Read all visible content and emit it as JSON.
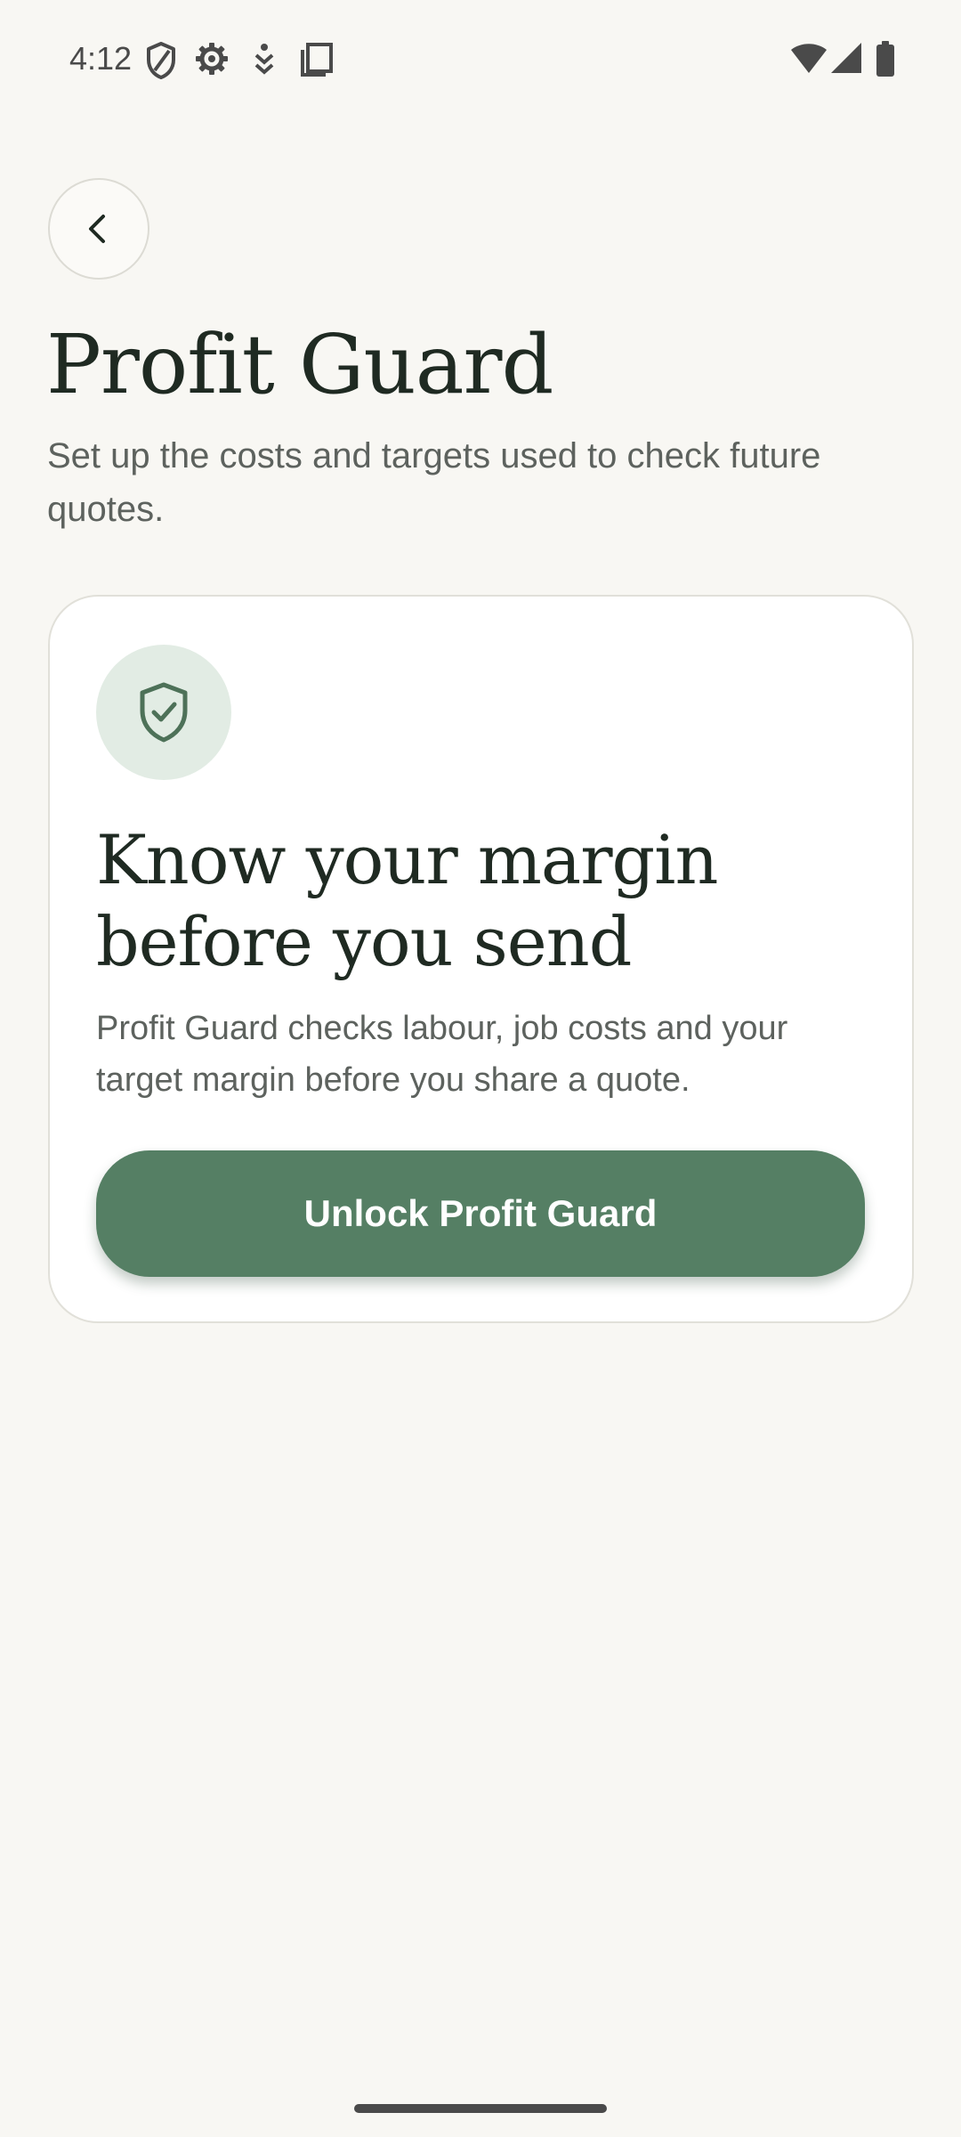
{
  "status_bar": {
    "time": "4:12",
    "left_icons": [
      "shield-status-icon",
      "gear-status-icon",
      "download-status-icon",
      "copy-status-icon"
    ],
    "right_icons": [
      "wifi-icon",
      "cellular-signal-icon",
      "battery-icon"
    ]
  },
  "header": {
    "back_icon": "chevron-left-icon",
    "title": "Profit Guard",
    "subtitle": "Set up the costs and targets used to check future quotes."
  },
  "card": {
    "icon": "shield-check-icon",
    "heading": "Know your margin before you send",
    "body": "Profit Guard checks labour, job costs and your target margin before you share a quote.",
    "button_label": "Unlock Profit Guard"
  },
  "colors": {
    "background": "#f8f7f3",
    "accent": "#557f64",
    "badge": "#e2ece4",
    "title": "#1f2a22",
    "secondary_text": "#5d625e"
  }
}
